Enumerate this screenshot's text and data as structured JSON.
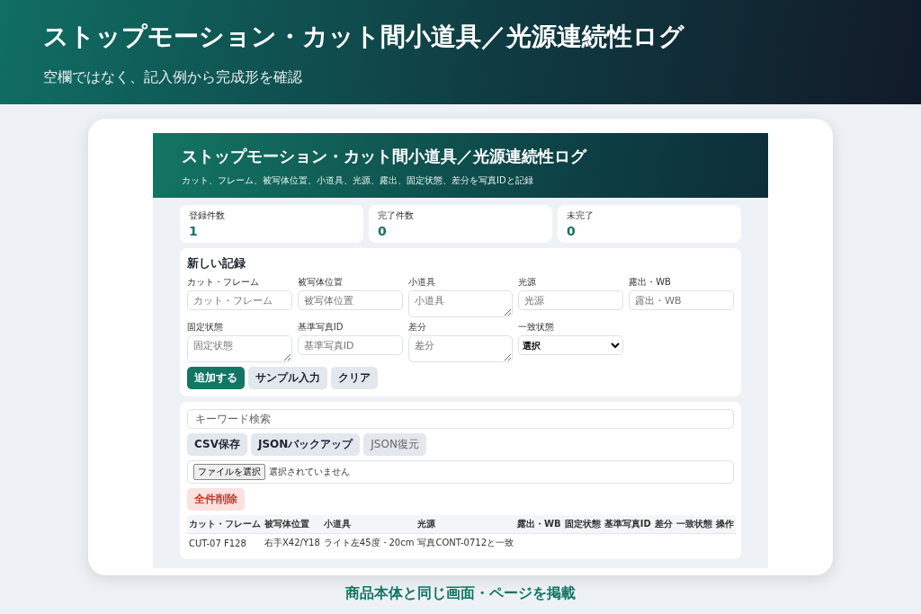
{
  "banner": {
    "title": "ストップモーション・カット間小道具／光源連続性ログ",
    "subtitle": "空欄ではなく、記入例から完成形を確認"
  },
  "app": {
    "header": {
      "title": "ストップモーション・カット間小道具／光源連続性ログ",
      "subtitle": "カット、フレーム、被写体位置、小道具、光源、露出、固定状態、差分を写真IDと記録"
    },
    "stats": [
      {
        "label": "登録件数",
        "value": "1"
      },
      {
        "label": "完了件数",
        "value": "0"
      },
      {
        "label": "未完了",
        "value": "0"
      }
    ],
    "form": {
      "title": "新しい記録",
      "fields": [
        {
          "label": "カット・フレーム",
          "placeholder": "カット・フレーム",
          "kind": "input"
        },
        {
          "label": "被写体位置",
          "placeholder": "被写体位置",
          "kind": "input"
        },
        {
          "label": "小道具",
          "placeholder": "小道具",
          "kind": "textarea"
        },
        {
          "label": "光源",
          "placeholder": "光源",
          "kind": "input"
        },
        {
          "label": "露出・WB",
          "placeholder": "露出・WB",
          "kind": "input"
        },
        {
          "label": "固定状態",
          "placeholder": "固定状態",
          "kind": "textarea"
        },
        {
          "label": "基準写真ID",
          "placeholder": "基準写真ID",
          "kind": "input"
        },
        {
          "label": "差分",
          "placeholder": "差分",
          "kind": "textarea"
        },
        {
          "label": "一致状態",
          "value": "選択",
          "kind": "select"
        }
      ],
      "buttons": [
        {
          "label": "追加する",
          "kind": "primary"
        },
        {
          "label": "サンプル入力",
          "kind": "secondary"
        },
        {
          "label": "クリア",
          "kind": "secondary"
        }
      ]
    },
    "list": {
      "search": {
        "placeholder": "キーワード検索"
      },
      "buttons": [
        {
          "label": "CSV保存",
          "kind": "secondary"
        },
        {
          "label": "JSONバックアップ",
          "kind": "secondary"
        },
        {
          "label": "JSON復元",
          "kind": "faint"
        }
      ],
      "file": {
        "button": "ファイルを選択",
        "status": "選択されていません"
      },
      "delete_all": "全件削除",
      "table": {
        "columns": [
          "カット・フレーム",
          "被写体位置",
          "小道具",
          "光源",
          "露出・WB",
          "固定状態",
          "基準写真ID",
          "差分",
          "一致状態",
          "操作"
        ],
        "rows": [
          [
            "CUT-07 F128",
            "右手X42/Y18",
            "ライト左45度・20cm",
            "写真CONT-0712と一致",
            "",
            "",
            "",
            "",
            "",
            ""
          ]
        ]
      }
    }
  },
  "caption": "商品本体と同じ画面・ページを掲載"
}
